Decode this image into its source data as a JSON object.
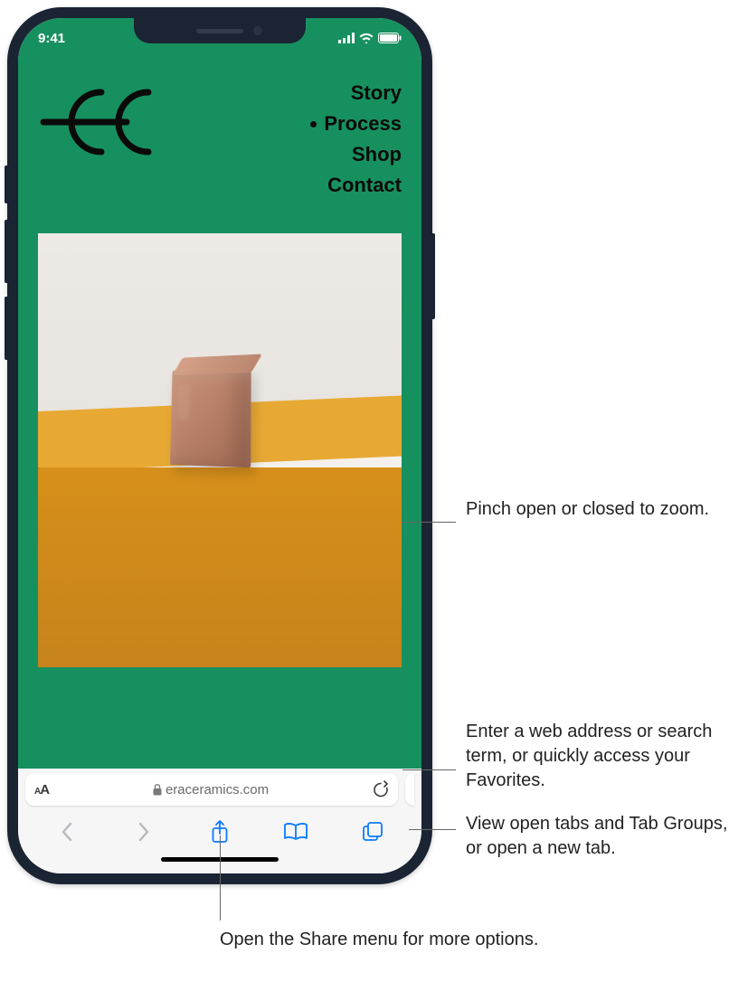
{
  "status": {
    "time": "9:41",
    "signal_icon": "signal-icon",
    "wifi_icon": "wifi-icon",
    "battery_icon": "battery-icon"
  },
  "page": {
    "nav": {
      "items": [
        "Story",
        "Process",
        "Shop",
        "Contact"
      ],
      "active_index": 1
    }
  },
  "address_bar": {
    "aa_icon": "aa-icon",
    "lock_icon": "lock-icon",
    "domain": "eraceramics.com",
    "reload_icon": "reload-icon"
  },
  "toolbar": {
    "back_icon": "chevron-left-icon",
    "forward_icon": "chevron-right-icon",
    "share_icon": "share-icon",
    "bookmarks_icon": "book-icon",
    "tabs_icon": "tabs-icon"
  },
  "callouts": {
    "zoom": "Pinch open or closed to zoom.",
    "address": "Enter a web address or search term, or quickly access your Favorites.",
    "tabs": "View open tabs and Tab Groups, or open a new tab.",
    "share": "Open the Share menu for more options."
  }
}
